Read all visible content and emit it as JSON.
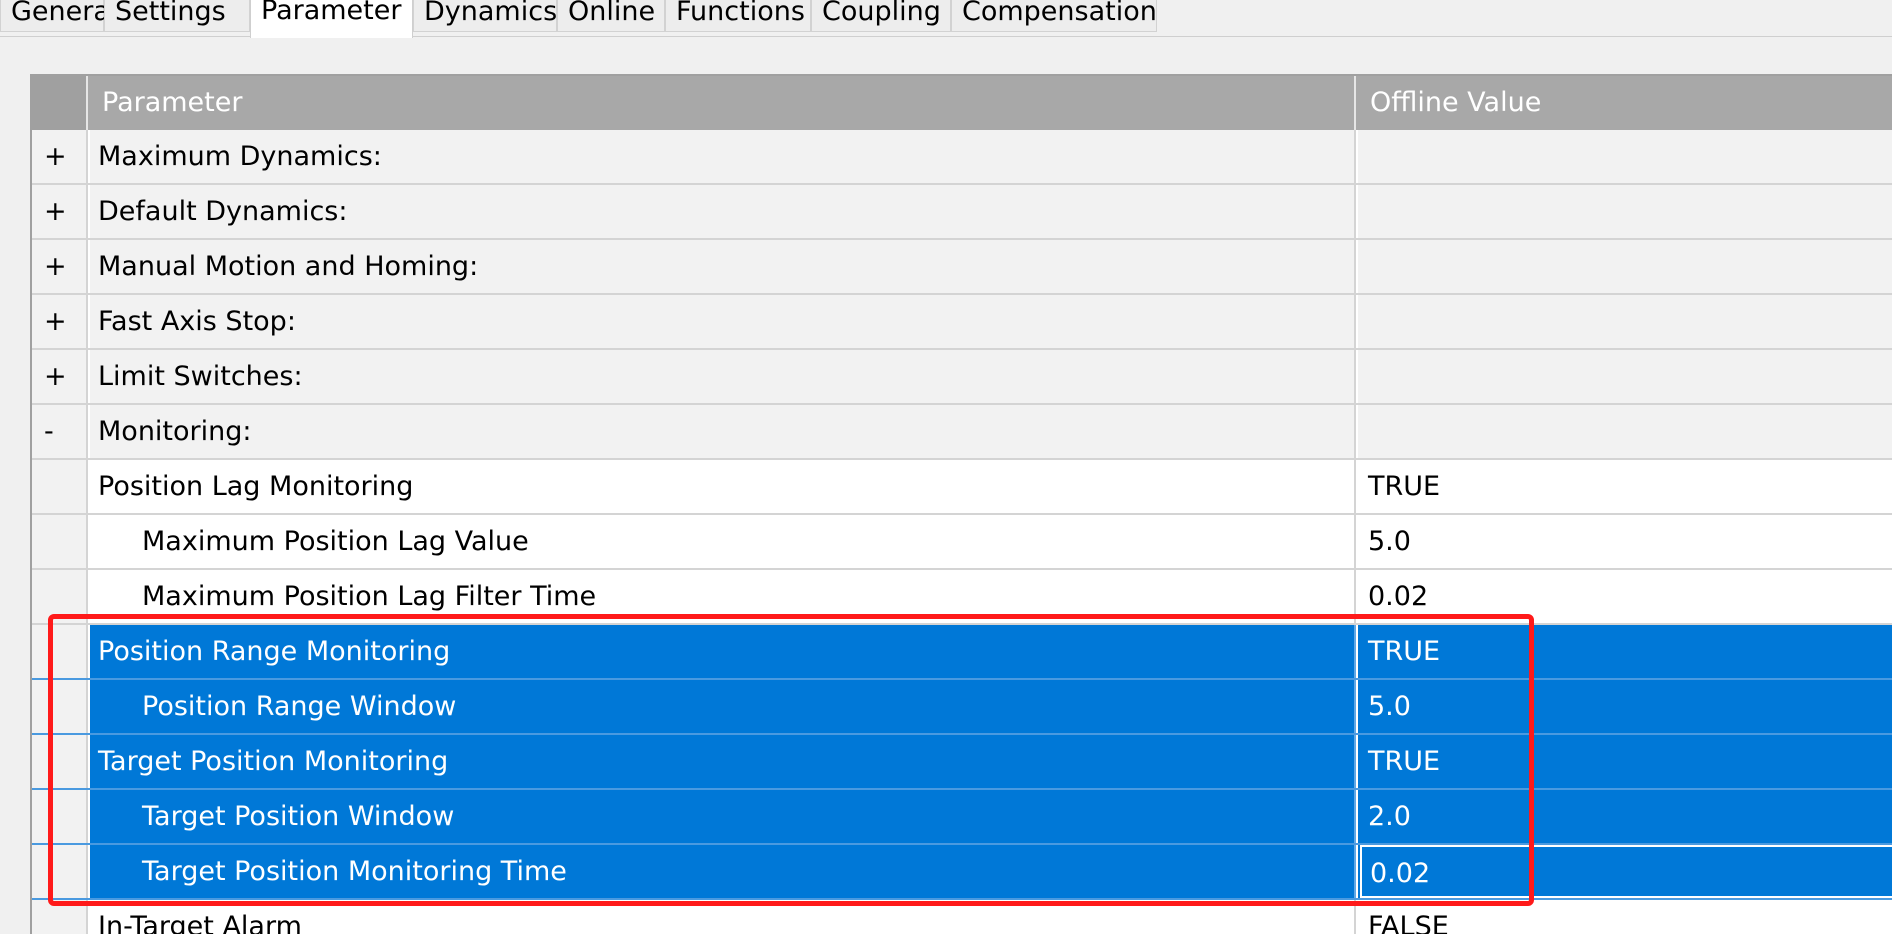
{
  "tabs": [
    {
      "label": "General",
      "active": false
    },
    {
      "label": "Settings",
      "active": false
    },
    {
      "label": "Parameter",
      "active": true
    },
    {
      "label": "Dynamics",
      "active": false
    },
    {
      "label": "Online",
      "active": false
    },
    {
      "label": "Functions",
      "active": false
    },
    {
      "label": "Coupling",
      "active": false
    },
    {
      "label": "Compensation",
      "active": false
    }
  ],
  "grid": {
    "header": {
      "parameter": "Parameter",
      "offline_value": "Offline Value"
    },
    "rows": [
      {
        "expander": "+",
        "name": "Maximum Dynamics:",
        "value": "",
        "type": "group"
      },
      {
        "expander": "+",
        "name": "Default Dynamics:",
        "value": "",
        "type": "group"
      },
      {
        "expander": "+",
        "name": "Manual Motion and Homing:",
        "value": "",
        "type": "group"
      },
      {
        "expander": "+",
        "name": "Fast Axis Stop:",
        "value": "",
        "type": "group"
      },
      {
        "expander": "+",
        "name": "Limit Switches:",
        "value": "",
        "type": "group"
      },
      {
        "expander": "-",
        "name": "Monitoring:",
        "value": "",
        "type": "group"
      },
      {
        "expander": "",
        "name": "Position Lag Monitoring",
        "value": "TRUE",
        "type": "item",
        "indent": 0
      },
      {
        "expander": "",
        "name": "Maximum Position Lag Value",
        "value": "5.0",
        "type": "item",
        "indent": 1
      },
      {
        "expander": "",
        "name": "Maximum Position Lag Filter Time",
        "value": "0.02",
        "type": "item",
        "indent": 1
      },
      {
        "expander": "",
        "name": "Position Range Monitoring",
        "value": "TRUE",
        "type": "item",
        "indent": 0,
        "selected": true
      },
      {
        "expander": "",
        "name": "Position Range Window",
        "value": "5.0",
        "type": "item",
        "indent": 1,
        "selected": true
      },
      {
        "expander": "",
        "name": "Target Position Monitoring",
        "value": "TRUE",
        "type": "item",
        "indent": 0,
        "selected": true
      },
      {
        "expander": "",
        "name": "Target Position Window",
        "value": "2.0",
        "type": "item",
        "indent": 1,
        "selected": true
      },
      {
        "expander": "",
        "name": "Target Position Monitoring Time",
        "value": "0.02",
        "type": "item",
        "indent": 1,
        "selected": true,
        "focused": true
      },
      {
        "expander": "",
        "name": "In-Target Alarm",
        "value": "FALSE",
        "type": "item",
        "indent": 0
      }
    ]
  },
  "colors": {
    "selection": "#0078d7",
    "highlight_box": "#ff1a1a",
    "header": "#a8a8a8"
  }
}
